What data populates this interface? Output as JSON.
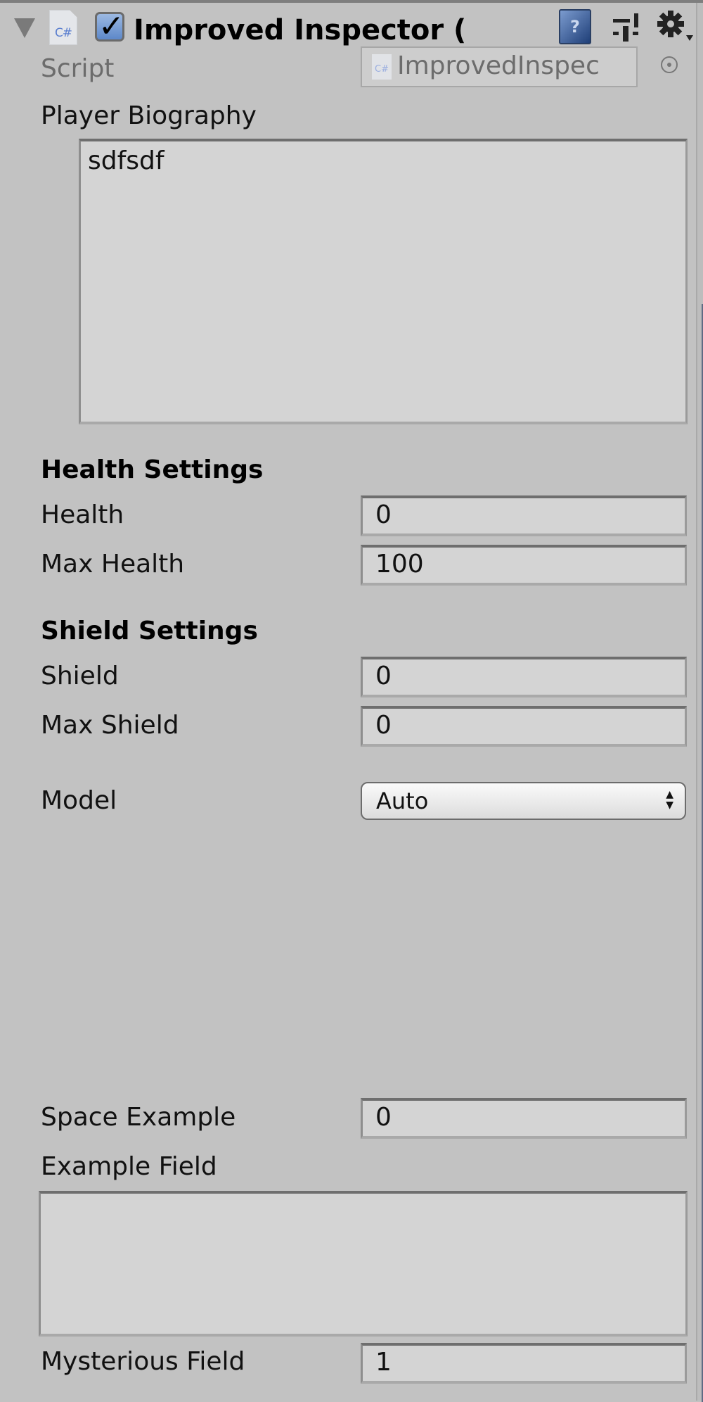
{
  "component": {
    "title": "Improved Inspector (",
    "enabled": true,
    "icons": {
      "fold": "triangle-down",
      "script": "csharp-file-icon",
      "help": "help-book-icon",
      "presets": "presets-sliders-icon",
      "settings": "gear-icon"
    },
    "script_icon_text": "C#",
    "help_icon_text": "?"
  },
  "script_field": {
    "label": "Script",
    "value": "ImprovedInspec",
    "icon_text": "C#"
  },
  "biography": {
    "label": "Player Biography",
    "value": "sdfsdf"
  },
  "health_settings": {
    "header": "Health Settings",
    "fields": [
      {
        "label": "Health",
        "value": "0"
      },
      {
        "label": "Max Health",
        "value": "100"
      }
    ]
  },
  "shield_settings": {
    "header": "Shield Settings",
    "fields": [
      {
        "label": "Shield",
        "value": "0"
      },
      {
        "label": "Max Shield",
        "value": "0"
      }
    ]
  },
  "model": {
    "label": "Model",
    "selected": "Auto",
    "arrows": "▲▼"
  },
  "space_example": {
    "label": "Space Example",
    "value": "0"
  },
  "example_field": {
    "label": "Example Field",
    "value": ""
  },
  "mysterious_field": {
    "label": "Mysterious Field",
    "value": "1"
  }
}
